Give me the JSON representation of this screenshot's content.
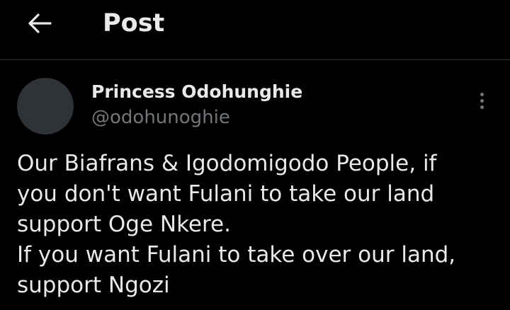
{
  "header": {
    "back_icon": "arrow-left-icon",
    "title": "Post"
  },
  "post": {
    "author_name": "Princess Odohunghie",
    "author_handle": "@odohunoghie",
    "more_icon": "more-vertical-icon",
    "lines": [
      "Our Biafrans & Igodomigodo People, if",
      "you don't want Fulani to take our land",
      "support Oge Nkere.",
      "If you want Fulani to take over our land,",
      "support Ngozi"
    ]
  },
  "colors": {
    "background": "#000000",
    "primary_text": "#e7e9ea",
    "secondary_text": "#71767b",
    "divider": "#2f3336",
    "avatar_placeholder": "#2f3337"
  }
}
